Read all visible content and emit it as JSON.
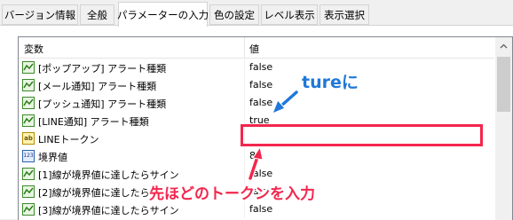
{
  "tabs": [
    {
      "label": "バージョン情報"
    },
    {
      "label": "全般"
    },
    {
      "label": "パラメーターの入力",
      "active": true
    },
    {
      "label": "色の設定"
    },
    {
      "label": "レベル表示"
    },
    {
      "label": "表示選択"
    }
  ],
  "table": {
    "columns": [
      "変数",
      "値"
    ],
    "rows": [
      {
        "icon": "input-param-icon",
        "name": "[ポップアップ] アラート種類",
        "value": "false"
      },
      {
        "icon": "input-param-icon",
        "name": "[メール通知] アラート種類",
        "value": "false"
      },
      {
        "icon": "input-param-icon",
        "name": "[プッシュ通知] アラート種類",
        "value": "false"
      },
      {
        "icon": "input-param-icon",
        "name": "[LINE通知] アラート種類",
        "value": "true"
      },
      {
        "icon": "string-param-icon",
        "icon_text": "ab",
        "name": "LINEトークン",
        "value": ""
      },
      {
        "icon": "number-param-icon",
        "icon_text": "123",
        "name": "境界値",
        "value": "80"
      },
      {
        "icon": "input-param-icon",
        "name": "[1]線が境界値に達したらサイン",
        "value": "false"
      },
      {
        "icon": "input-param-icon",
        "name": "[2]線が境界値に達したらサイン",
        "value": "false"
      },
      {
        "icon": "input-param-icon",
        "name": "[3]線が境界値に達したらサイン",
        "value": "false"
      }
    ]
  },
  "annotations": {
    "ture_callout": "tureに",
    "token_callout": "先ほどのトークンを入力",
    "highlight_color": "#f3264d",
    "callout_blue": "#1f78d9"
  }
}
